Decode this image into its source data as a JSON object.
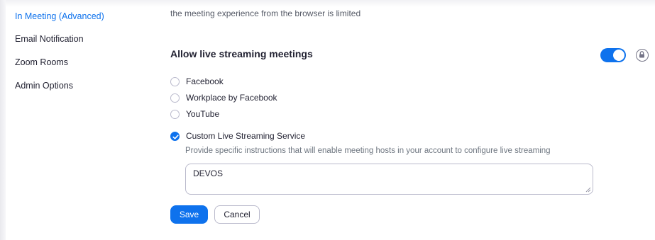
{
  "sidebar": {
    "items": [
      {
        "label": "In Meeting (Advanced)",
        "active": true
      },
      {
        "label": "Email Notification",
        "active": false
      },
      {
        "label": "Zoom Rooms",
        "active": false
      },
      {
        "label": "Admin Options",
        "active": false
      }
    ]
  },
  "main": {
    "top_description": "the meeting experience from the browser is limited",
    "section": {
      "title": "Allow live streaming meetings",
      "toggle_on": true,
      "lock_icon": "lock-icon"
    },
    "options": [
      {
        "label": "Facebook",
        "checked": false
      },
      {
        "label": "Workplace by Facebook",
        "checked": false
      },
      {
        "label": "YouTube",
        "checked": false
      },
      {
        "label": "Custom Live Streaming Service",
        "checked": true
      }
    ],
    "custom_hint": "Provide specific instructions that will enable meeting hosts in your account to configure live streaming",
    "instructions_value": "DEVOS",
    "buttons": {
      "save": "Save",
      "cancel": "Cancel"
    }
  },
  "colors": {
    "accent": "#0e72ed",
    "text": "#232333",
    "muted": "#6e7680",
    "border": "#babacc"
  }
}
